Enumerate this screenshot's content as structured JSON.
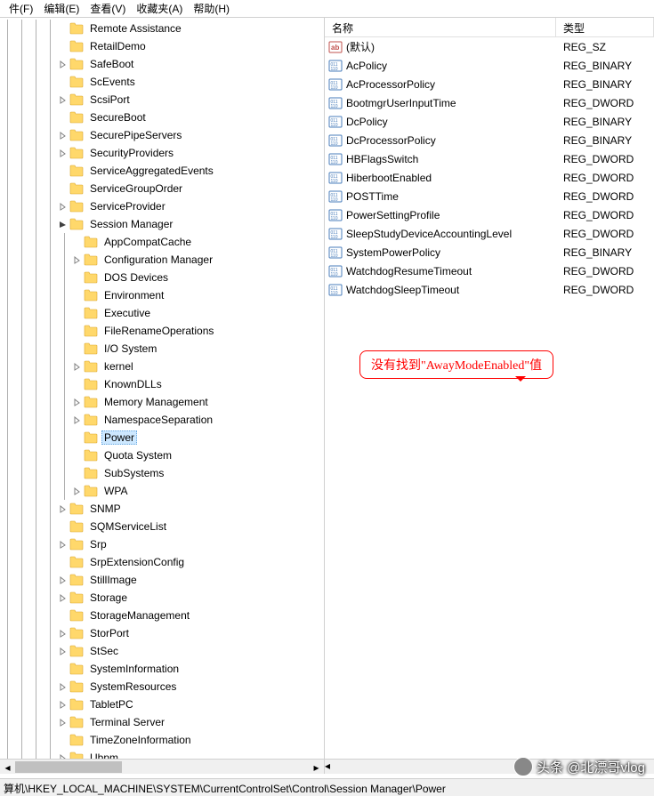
{
  "menu": {
    "file": "件(F)",
    "edit": "编辑(E)",
    "view": "查看(V)",
    "fav": "收藏夹(A)",
    "help": "帮助(H)"
  },
  "tree": [
    {
      "d": 4,
      "exp": null,
      "l": "Remote Assistance"
    },
    {
      "d": 4,
      "exp": null,
      "l": "RetailDemo"
    },
    {
      "d": 4,
      "exp": "c",
      "l": "SafeBoot"
    },
    {
      "d": 4,
      "exp": null,
      "l": "ScEvents"
    },
    {
      "d": 4,
      "exp": "c",
      "l": "ScsiPort"
    },
    {
      "d": 4,
      "exp": null,
      "l": "SecureBoot"
    },
    {
      "d": 4,
      "exp": "c",
      "l": "SecurePipeServers"
    },
    {
      "d": 4,
      "exp": "c",
      "l": "SecurityProviders"
    },
    {
      "d": 4,
      "exp": null,
      "l": "ServiceAggregatedEvents"
    },
    {
      "d": 4,
      "exp": null,
      "l": "ServiceGroupOrder"
    },
    {
      "d": 4,
      "exp": "c",
      "l": "ServiceProvider"
    },
    {
      "d": 4,
      "exp": "o",
      "l": "Session Manager"
    },
    {
      "d": 5,
      "exp": null,
      "l": "AppCompatCache"
    },
    {
      "d": 5,
      "exp": "c",
      "l": "Configuration Manager"
    },
    {
      "d": 5,
      "exp": null,
      "l": "DOS Devices"
    },
    {
      "d": 5,
      "exp": null,
      "l": "Environment"
    },
    {
      "d": 5,
      "exp": null,
      "l": "Executive"
    },
    {
      "d": 5,
      "exp": null,
      "l": "FileRenameOperations"
    },
    {
      "d": 5,
      "exp": null,
      "l": "I/O System"
    },
    {
      "d": 5,
      "exp": "c",
      "l": "kernel"
    },
    {
      "d": 5,
      "exp": null,
      "l": "KnownDLLs"
    },
    {
      "d": 5,
      "exp": "c",
      "l": "Memory Management"
    },
    {
      "d": 5,
      "exp": "c",
      "l": "NamespaceSeparation"
    },
    {
      "d": 5,
      "exp": null,
      "l": "Power",
      "sel": true
    },
    {
      "d": 5,
      "exp": null,
      "l": "Quota System"
    },
    {
      "d": 5,
      "exp": null,
      "l": "SubSystems"
    },
    {
      "d": 5,
      "exp": "c",
      "l": "WPA"
    },
    {
      "d": 4,
      "exp": "c",
      "l": "SNMP"
    },
    {
      "d": 4,
      "exp": null,
      "l": "SQMServiceList"
    },
    {
      "d": 4,
      "exp": "c",
      "l": "Srp"
    },
    {
      "d": 4,
      "exp": null,
      "l": "SrpExtensionConfig"
    },
    {
      "d": 4,
      "exp": "c",
      "l": "StillImage"
    },
    {
      "d": 4,
      "exp": "c",
      "l": "Storage"
    },
    {
      "d": 4,
      "exp": null,
      "l": "StorageManagement"
    },
    {
      "d": 4,
      "exp": "c",
      "l": "StorPort"
    },
    {
      "d": 4,
      "exp": "c",
      "l": "StSec"
    },
    {
      "d": 4,
      "exp": null,
      "l": "SystemInformation"
    },
    {
      "d": 4,
      "exp": "c",
      "l": "SystemResources"
    },
    {
      "d": 4,
      "exp": "c",
      "l": "TabletPC"
    },
    {
      "d": 4,
      "exp": "c",
      "l": "Terminal Server"
    },
    {
      "d": 4,
      "exp": null,
      "l": "TimeZoneInformation"
    },
    {
      "d": 4,
      "exp": "c",
      "l": "Ubpm"
    }
  ],
  "cols": {
    "name": "名称",
    "type": "类型"
  },
  "values": [
    {
      "icon": "sz",
      "n": "(默认)",
      "t": "REG_SZ"
    },
    {
      "icon": "bin",
      "n": "AcPolicy",
      "t": "REG_BINARY"
    },
    {
      "icon": "bin",
      "n": "AcProcessorPolicy",
      "t": "REG_BINARY"
    },
    {
      "icon": "bin",
      "n": "BootmgrUserInputTime",
      "t": "REG_DWORD"
    },
    {
      "icon": "bin",
      "n": "DcPolicy",
      "t": "REG_BINARY"
    },
    {
      "icon": "bin",
      "n": "DcProcessorPolicy",
      "t": "REG_BINARY"
    },
    {
      "icon": "bin",
      "n": "HBFlagsSwitch",
      "t": "REG_DWORD"
    },
    {
      "icon": "bin",
      "n": "HiberbootEnabled",
      "t": "REG_DWORD"
    },
    {
      "icon": "bin",
      "n": "POSTTime",
      "t": "REG_DWORD"
    },
    {
      "icon": "bin",
      "n": "PowerSettingProfile",
      "t": "REG_DWORD"
    },
    {
      "icon": "bin",
      "n": "SleepStudyDeviceAccountingLevel",
      "t": "REG_DWORD"
    },
    {
      "icon": "bin",
      "n": "SystemPowerPolicy",
      "t": "REG_BINARY"
    },
    {
      "icon": "bin",
      "n": "WatchdogResumeTimeout",
      "t": "REG_DWORD"
    },
    {
      "icon": "bin",
      "n": "WatchdogSleepTimeout",
      "t": "REG_DWORD"
    }
  ],
  "callout": "没有找到\"AwayModeEnabled\"值",
  "status": "算机\\HKEY_LOCAL_MACHINE\\SYSTEM\\CurrentControlSet\\Control\\Session Manager\\Power",
  "watermark": "头条 @北漂哥vlog"
}
